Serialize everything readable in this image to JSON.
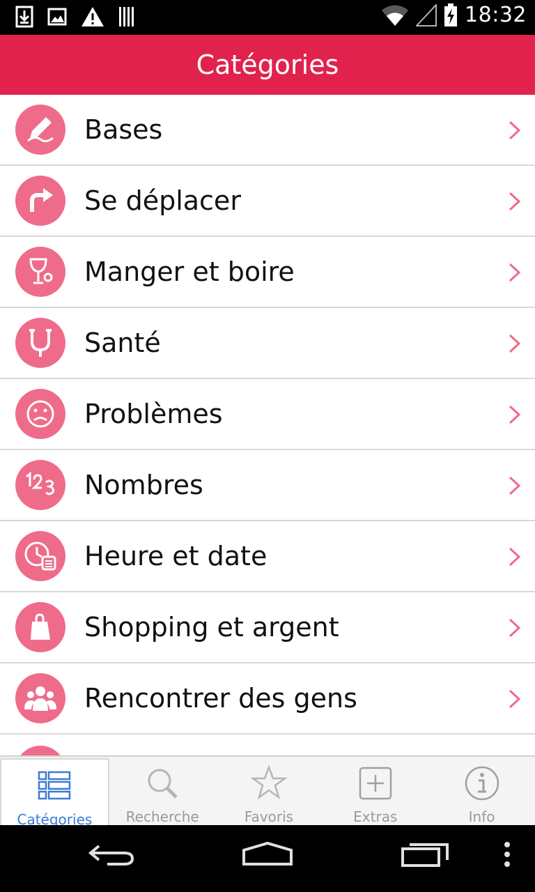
{
  "status_bar": {
    "time": "18:32",
    "icons": [
      "download-icon",
      "image-icon",
      "warning-icon",
      "barcode-icon",
      "wifi-icon",
      "signal-icon",
      "battery-icon"
    ]
  },
  "header": {
    "title": "Catégories"
  },
  "accent_color": "#e0224d",
  "icon_color": "#ef6b8a",
  "categories": [
    {
      "label": "Bases",
      "icon": "pencil-icon"
    },
    {
      "label": "Se déplacer",
      "icon": "turn-right-arrow-icon"
    },
    {
      "label": "Manger et boire",
      "icon": "wine-glass-icon"
    },
    {
      "label": "Santé",
      "icon": "stethoscope-icon"
    },
    {
      "label": "Problèmes",
      "icon": "sad-face-icon"
    },
    {
      "label": "Nombres",
      "icon": "numbers-123-icon"
    },
    {
      "label": "Heure et date",
      "icon": "clock-calendar-icon"
    },
    {
      "label": "Shopping et argent",
      "icon": "shopping-bag-icon"
    },
    {
      "label": "Rencontrer des gens",
      "icon": "people-icon"
    }
  ],
  "tabs": [
    {
      "label": "Catégories",
      "icon": "list-grid-icon",
      "active": true
    },
    {
      "label": "Recherche",
      "icon": "search-icon",
      "active": false
    },
    {
      "label": "Favoris",
      "icon": "star-icon",
      "active": false
    },
    {
      "label": "Extras",
      "icon": "plus-box-icon",
      "active": false
    },
    {
      "label": "Info",
      "icon": "info-icon",
      "active": false
    }
  ]
}
